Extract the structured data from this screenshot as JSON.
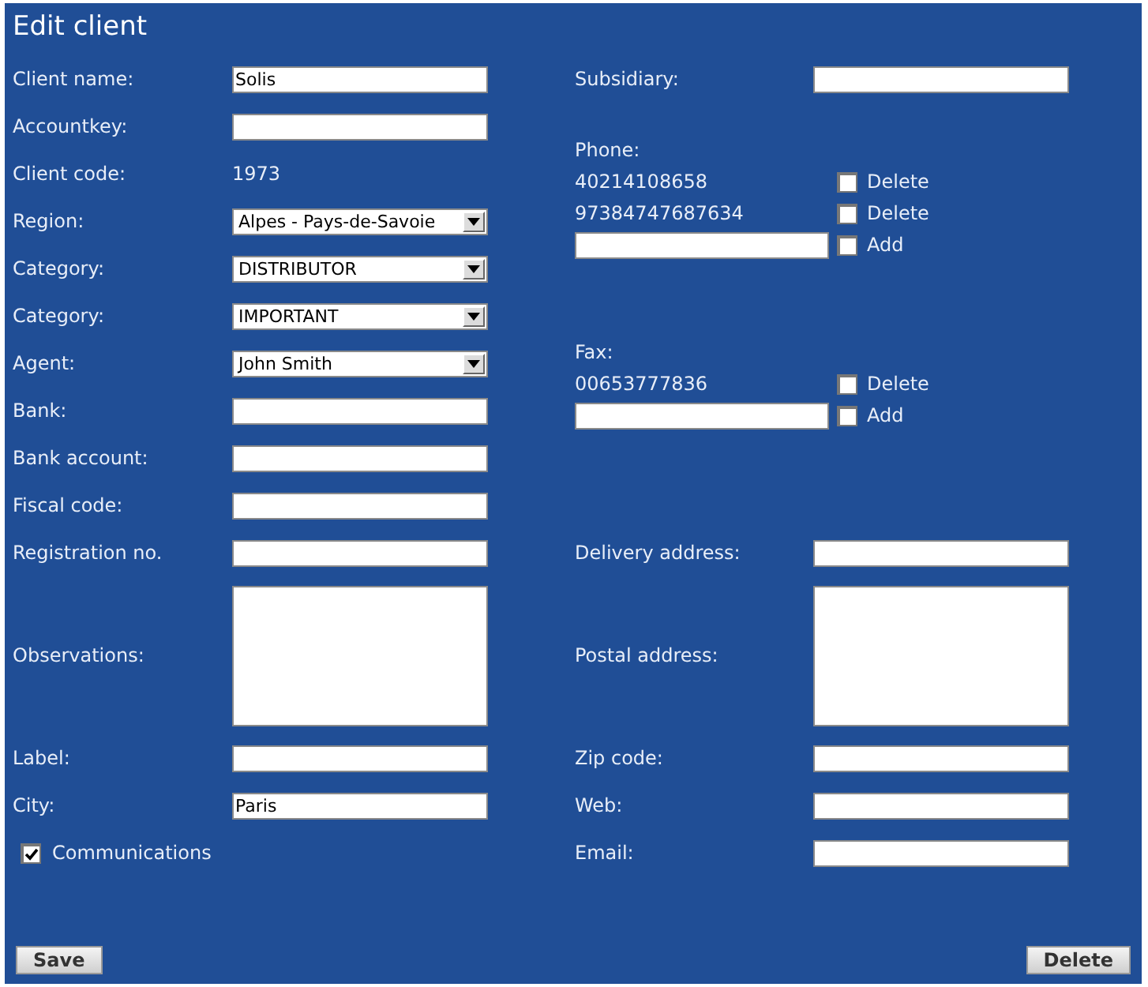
{
  "title": "Edit client",
  "left_fields": [
    {
      "kind": "text",
      "label": "Client name:",
      "value": "Solis"
    },
    {
      "kind": "text",
      "label": "Accountkey:"
    },
    {
      "kind": "static",
      "label": "Client code:",
      "value": "1973"
    },
    {
      "kind": "select",
      "label": "Region:",
      "value": "Alpes - Pays-de-Savoie"
    },
    {
      "kind": "select",
      "label": "Category:",
      "value": "DISTRIBUTOR"
    },
    {
      "kind": "select",
      "label": "Category:",
      "value": "IMPORTANT"
    },
    {
      "kind": "select",
      "label": "Agent:",
      "value": "John Smith"
    },
    {
      "kind": "text",
      "label": "Bank:"
    },
    {
      "kind": "text",
      "label": "Bank account:"
    },
    {
      "kind": "text",
      "label": "Fiscal code:"
    },
    {
      "kind": "text",
      "label": "Registration no."
    },
    {
      "kind": "textarea",
      "label": "Observations:"
    },
    {
      "kind": "text",
      "label": "Label:"
    },
    {
      "kind": "text",
      "label": "City:",
      "value": "Paris"
    },
    {
      "kind": "checkbox",
      "label": "Communications",
      "checked": true
    }
  ],
  "right_top_fields": [
    {
      "kind": "text",
      "label": "Subsidiary:"
    }
  ],
  "contact_groups": [
    {
      "label": "Phone:",
      "entries": [
        {
          "number": "40214108658",
          "action": "Delete",
          "checked": false
        },
        {
          "number": "97384747687634",
          "action": "Delete",
          "checked": false
        }
      ],
      "add": {
        "label": "Add",
        "checked": false
      }
    },
    {
      "label": "Fax:",
      "entries": [
        {
          "number": "00653777836",
          "action": "Delete",
          "checked": false
        }
      ],
      "add": {
        "label": "Add",
        "checked": false
      }
    }
  ],
  "right_bottom_fields": [
    {
      "kind": "text",
      "label": "Delivery address:"
    },
    {
      "kind": "textarea",
      "label": "Postal address:"
    },
    {
      "kind": "text",
      "label": "Zip code:"
    },
    {
      "kind": "text",
      "label": "Web:"
    },
    {
      "kind": "text",
      "label": "Email:"
    }
  ],
  "buttons": {
    "save": "Save",
    "delete": "Delete"
  }
}
